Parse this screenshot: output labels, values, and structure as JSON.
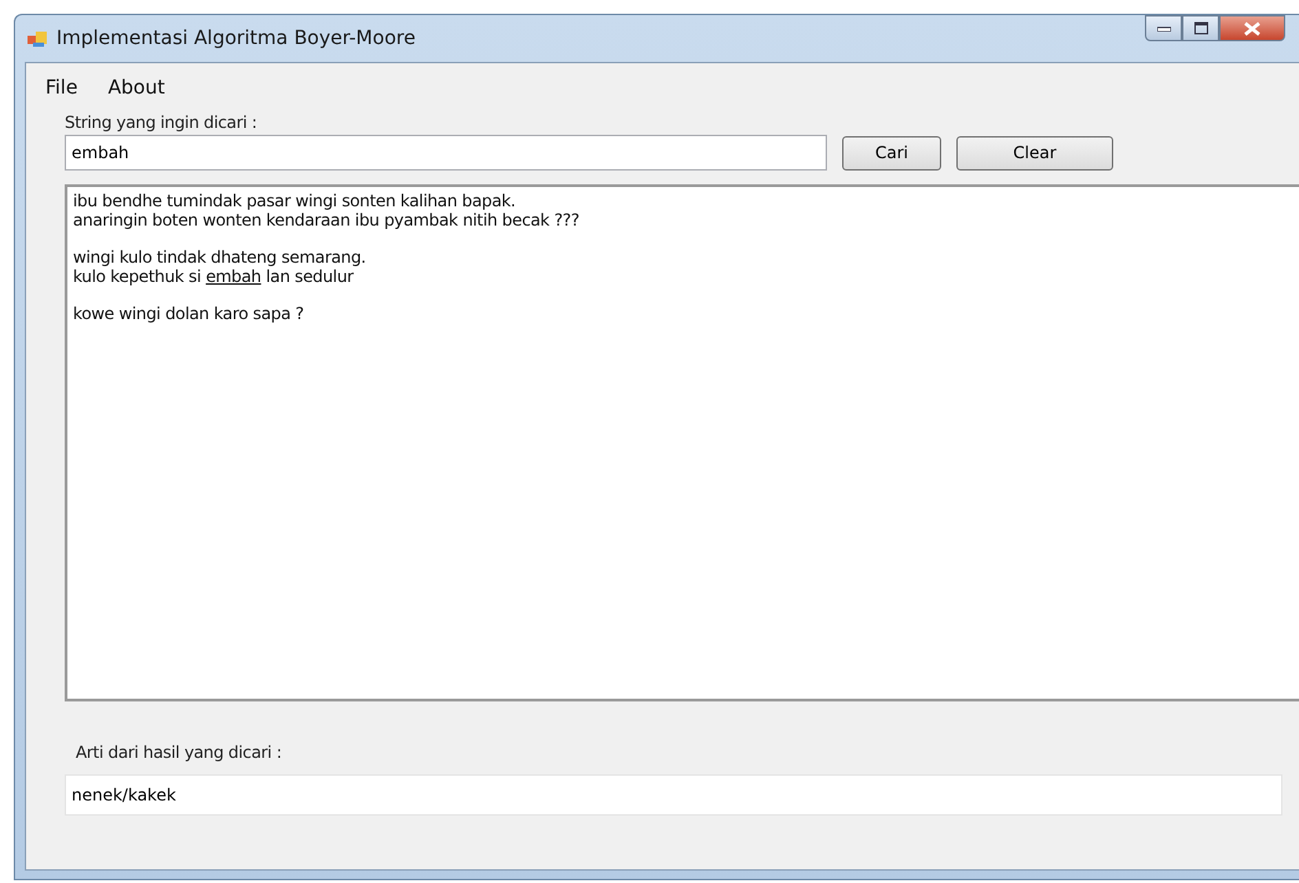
{
  "window": {
    "title": "Implementasi Algoritma Boyer-Moore"
  },
  "menu": [
    "File",
    "About"
  ],
  "search": {
    "label": "String yang ingin dicari :",
    "value": "embah"
  },
  "buttons": [
    "Cari",
    "Clear"
  ],
  "text_area": {
    "paragraphs": [
      [
        {
          "segments": [
            {
              "text": "ibu bendhe tumindak pasar wingi sonten kalihan bapak.",
              "highlighted": false
            }
          ]
        },
        {
          "segments": [
            {
              "text": "anaringin boten wonten kendaraan ibu pyambak nitih becak ???",
              "highlighted": false
            }
          ]
        }
      ],
      [
        {
          "segments": [
            {
              "text": "wingi kulo tindak dhateng semarang.",
              "highlighted": false
            }
          ]
        },
        {
          "segments": [
            {
              "text": "kulo kepethuk si ",
              "highlighted": false
            },
            {
              "text": "embah",
              "highlighted": true
            },
            {
              "text": " lan sedulur",
              "highlighted": false
            }
          ]
        }
      ],
      [
        {
          "segments": [
            {
              "text": "kowe wingi dolan karo sapa ?",
              "highlighted": false
            }
          ]
        }
      ]
    ]
  },
  "result": {
    "label": "Arti dari hasil yang dicari :",
    "value": "nenek/kakek"
  }
}
